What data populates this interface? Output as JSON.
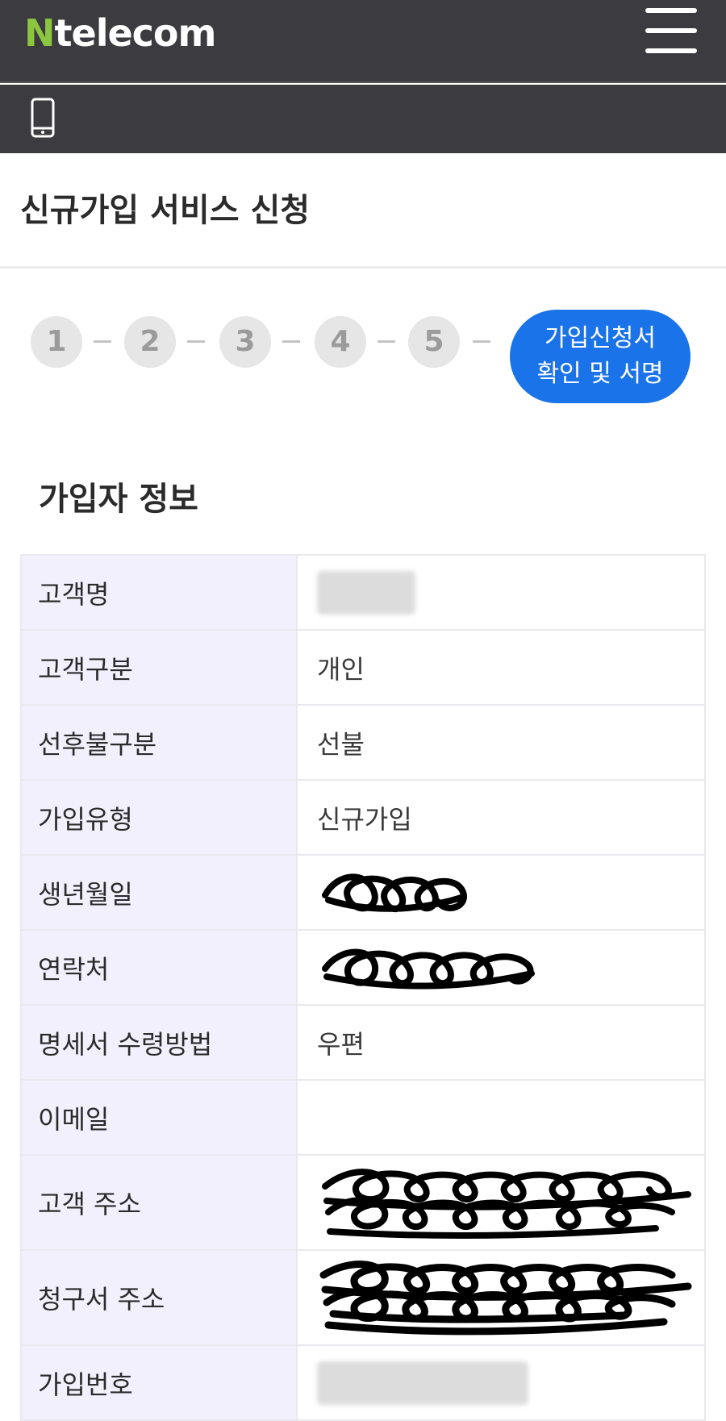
{
  "header": {
    "logo_n": "N",
    "logo_rest": "telecom"
  },
  "page": {
    "title": "신규가입 서비스 신청"
  },
  "steps": {
    "items": [
      "1",
      "2",
      "3",
      "4",
      "5"
    ],
    "current_line1": "가입신청서",
    "current_line2": "확인 및 서명"
  },
  "section": {
    "title": "가입자 정보"
  },
  "table": {
    "rows": [
      {
        "label": "고객명",
        "value": ""
      },
      {
        "label": "고객구분",
        "value": "개인"
      },
      {
        "label": "선후불구분",
        "value": "선불"
      },
      {
        "label": "가입유형",
        "value": "신규가입"
      },
      {
        "label": "생년월일",
        "value": ""
      },
      {
        "label": "연락처",
        "value": ""
      },
      {
        "label": "명세서 수령방법",
        "value": "우편"
      },
      {
        "label": "이메일",
        "value": ""
      },
      {
        "label": "고객 주소",
        "value": ""
      },
      {
        "label": "청구서 주소",
        "value": ""
      },
      {
        "label": "가입번호",
        "value": ""
      }
    ]
  },
  "colors": {
    "header_bg": "#3b3b40",
    "logo_accent": "#8cc63f",
    "step_active": "#1a73e8",
    "label_bg": "#f2f0fc"
  },
  "icons": {
    "menu": "hamburger-menu-icon",
    "device": "smartphone-icon"
  }
}
